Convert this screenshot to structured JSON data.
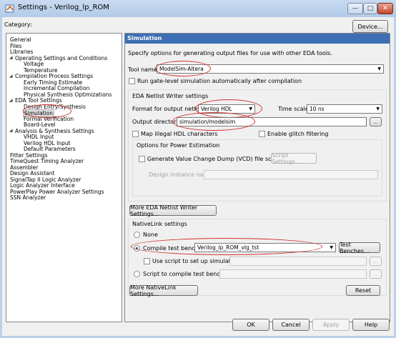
{
  "window": {
    "title": "Settings - Verilog_lp_ROM"
  },
  "category_label": "Category:",
  "device_button": "Device...",
  "tree": [
    {
      "label": "General"
    },
    {
      "label": "Files"
    },
    {
      "label": "Libraries"
    },
    {
      "label": "Operating Settings and Conditions"
    },
    {
      "label": "Voltage"
    },
    {
      "label": "Temperature"
    },
    {
      "label": "Compilation Process Settings"
    },
    {
      "label": "Early Timing Estimate"
    },
    {
      "label": "Incremental Compilation"
    },
    {
      "label": "Physical Synthesis Optimizations"
    },
    {
      "label": "EDA Tool Settings"
    },
    {
      "label": "Design Entry/Synthesis"
    },
    {
      "label": "Simulation"
    },
    {
      "label": "Formal Verification"
    },
    {
      "label": "Board-Level"
    },
    {
      "label": "Analysis & Synthesis Settings"
    },
    {
      "label": "VHDL Input"
    },
    {
      "label": "Verilog HDL Input"
    },
    {
      "label": "Default Parameters"
    },
    {
      "label": "Fitter Settings"
    },
    {
      "label": "TimeQuest Timing Analyzer"
    },
    {
      "label": "Assembler"
    },
    {
      "label": "Design Assistant"
    },
    {
      "label": "SignalTap II Logic Analyzer"
    },
    {
      "label": "Logic Analyzer Interface"
    },
    {
      "label": "PowerPlay Power Analyzer Settings"
    },
    {
      "label": "SSN Analyzer"
    }
  ],
  "panel": {
    "header": "Simulation",
    "description": "Specify options for generating output files for use with other EDA tools.",
    "tool_name_label": "Tool name:",
    "tool_name_value": "ModelSim-Altera",
    "run_gate_label": "Run gate-level simulation automatically after compilation",
    "eda_group_title": "EDA Netlist Writer settings",
    "format_label": "Format for output netlist:",
    "format_value": "Verilog HDL",
    "timescale_label": "Time scale:",
    "timescale_value": "10 ns",
    "outdir_label": "Output directory:",
    "outdir_value": "simulation/modelsim",
    "browse": "...",
    "map_illegal_label": "Map illegal HDL characters",
    "glitch_label": "Enable glitch filtering",
    "power_group_title": "Options for Power Estimation",
    "vcd_label": "Generate Value Change Dump (VCD) file script",
    "script_settings": "Script Settings...",
    "instance_label": "Design instance name:",
    "more_eda": "More EDA Netlist Writer Settings...",
    "nativelink_title": "NativeLink settings",
    "none_label": "None",
    "compile_tb_label": "Compile test bench:",
    "compile_tb_value": "Verilog_lp_ROM_vlg_tst",
    "test_benches": "Test Benches...",
    "use_script_label": "Use script to set up simulation:",
    "script_compile_label": "Script to compile test bench:",
    "more_nativelink": "More NativeLink Settings...",
    "reset": "Reset"
  },
  "footer": {
    "ok": "OK",
    "cancel": "Cancel",
    "apply": "Apply",
    "help": "Help"
  }
}
